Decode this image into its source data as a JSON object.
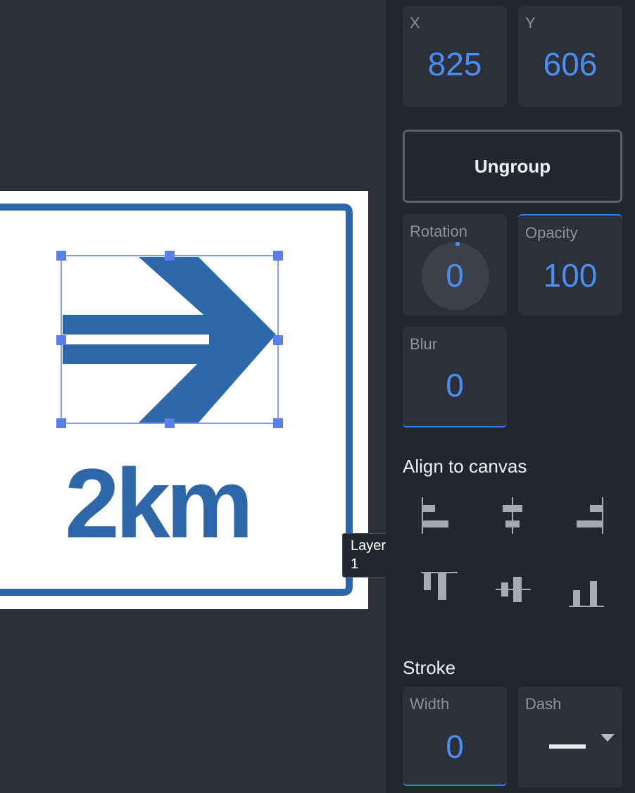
{
  "canvas": {
    "sign_text": "2km",
    "tooltip": "Layer 1",
    "colors": {
      "sign_blue": "#2e66aa",
      "selection": "#5b7fe8"
    }
  },
  "panel": {
    "x": {
      "label": "X",
      "value": "825"
    },
    "y": {
      "label": "Y",
      "value": "606"
    },
    "ungroup_label": "Ungroup",
    "rotation": {
      "label": "Rotation",
      "value": "0"
    },
    "opacity": {
      "label": "Opacity",
      "value": "100"
    },
    "blur": {
      "label": "Blur",
      "value": "0"
    },
    "align_title": "Align to canvas",
    "align_buttons": [
      "align-left-icon",
      "align-center-horizontal-icon",
      "align-right-icon",
      "align-top-icon",
      "align-center-vertical-icon",
      "align-bottom-icon"
    ],
    "stroke_title": "Stroke",
    "stroke_width": {
      "label": "Width",
      "value": "0"
    },
    "stroke_dash": {
      "label": "Dash"
    }
  }
}
